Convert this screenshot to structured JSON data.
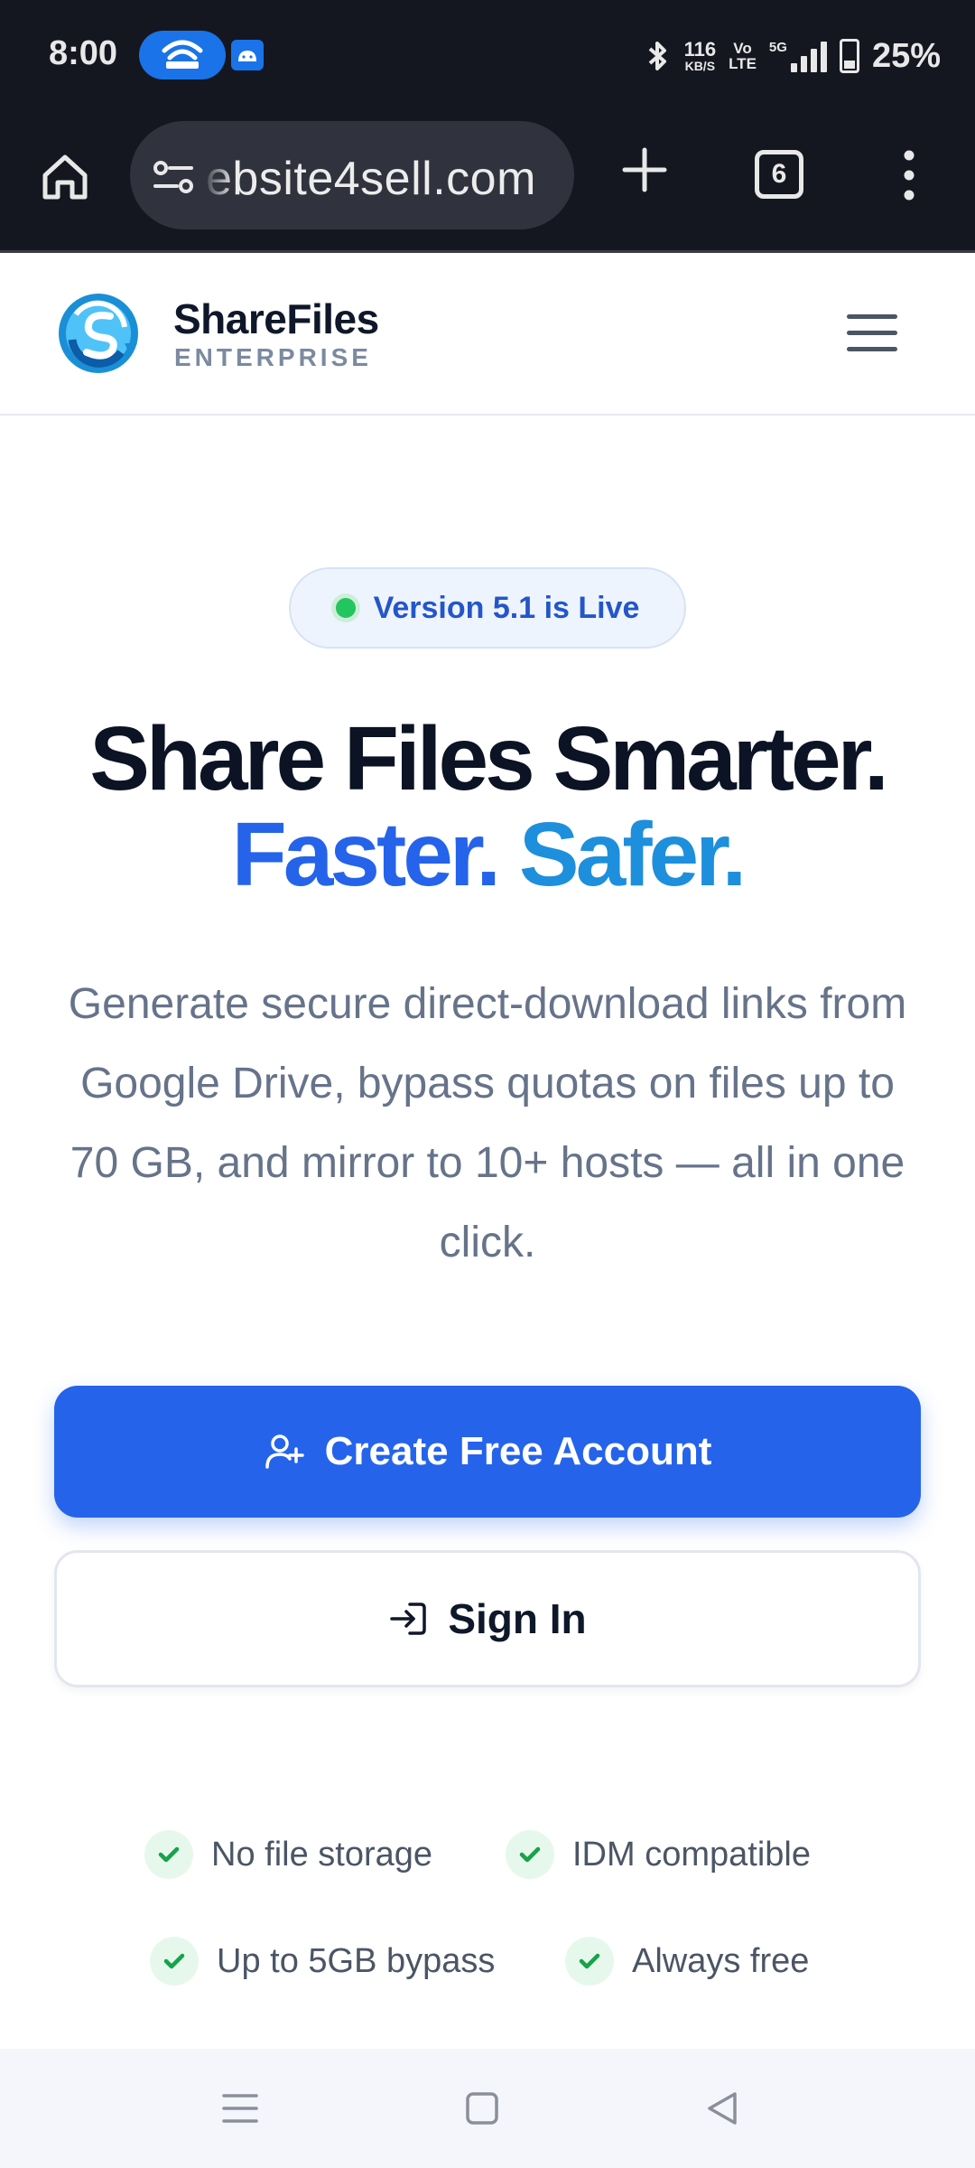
{
  "status_bar": {
    "time": "8:00",
    "net_speed_top": "116",
    "net_speed_unit": "KB/S",
    "volte_top": "Vo",
    "volte_bottom": "LTE",
    "network": "5G",
    "battery": "25%"
  },
  "browser": {
    "url": "ebsite4sell.com",
    "tab_count": "6"
  },
  "header": {
    "brand_name": "ShareFiles",
    "brand_sub": "ENTERPRISE"
  },
  "hero": {
    "badge": "Version 5.1 is Live",
    "title_line1": "Share Files Smarter.",
    "title_faster": "Faster.",
    "title_safer": "Safer.",
    "description": "Generate secure direct-download links from Google Drive, bypass quotas on files up to 70 GB, and mirror to 10+ hosts — all in one click."
  },
  "buttons": {
    "create_account": "Create Free Account",
    "sign_in": "Sign In"
  },
  "features": [
    {
      "label": "No file storage"
    },
    {
      "label": "IDM compatible"
    },
    {
      "label": "Up to 5GB bypass"
    },
    {
      "label": "Always free"
    }
  ],
  "colors": {
    "primary": "#2563eb",
    "accent": "#1e8fdc",
    "success": "#22c55e"
  }
}
